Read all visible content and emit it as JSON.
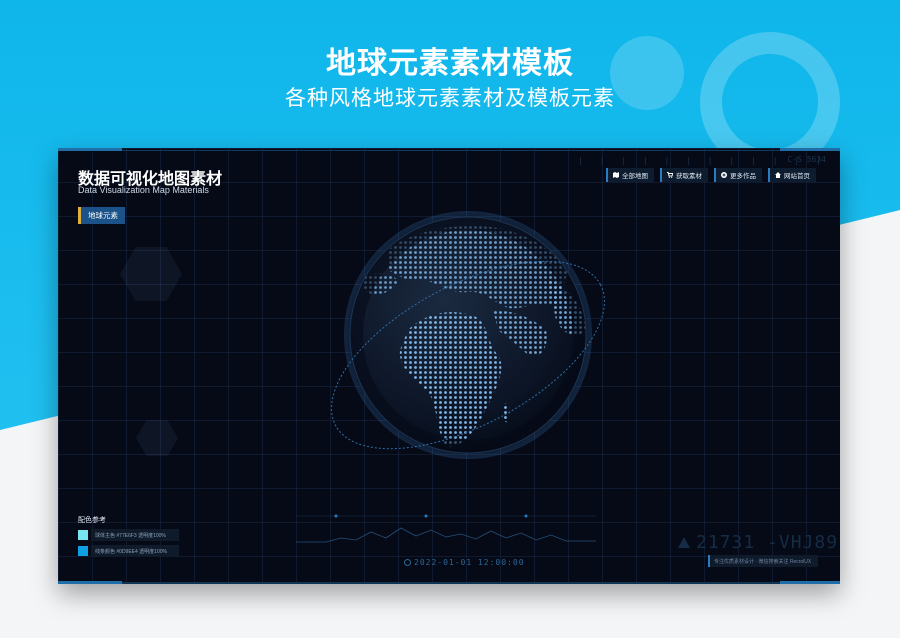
{
  "hero": {
    "title": "地球元素素材模板",
    "subtitle": "各种风格地球元素素材及模板元素"
  },
  "dashboard": {
    "title": "数据可视化地图素材",
    "subtitle": "Data Visualization Map Materials",
    "tag": "地球元素",
    "top_code": "C-S 5634",
    "nav": [
      {
        "label": "全部地图",
        "icon": "map-icon"
      },
      {
        "label": "获取素材",
        "icon": "cart-icon"
      },
      {
        "label": "更多作品",
        "icon": "plus-circle-icon"
      },
      {
        "label": "网站首页",
        "icon": "home-icon"
      }
    ],
    "legend": {
      "title": "配色参考",
      "items": [
        {
          "color": "#77E6F3",
          "label": "球体主色 #77E6F3 透明度100%"
        },
        {
          "color": "#0D9EE4",
          "label": "线条颜色 #0D9EE4 透明度100%"
        }
      ]
    },
    "time": "2022-01-01  12:00:00",
    "big_code": "21731 -VHJ89",
    "note": "专注优质素材设计 · 微信搜索关注 RecrolUX",
    "colors": {
      "accent": "#2a7bc0",
      "globe_dot": "#7fb6e8",
      "tag_bar": "#e0b03a"
    }
  }
}
